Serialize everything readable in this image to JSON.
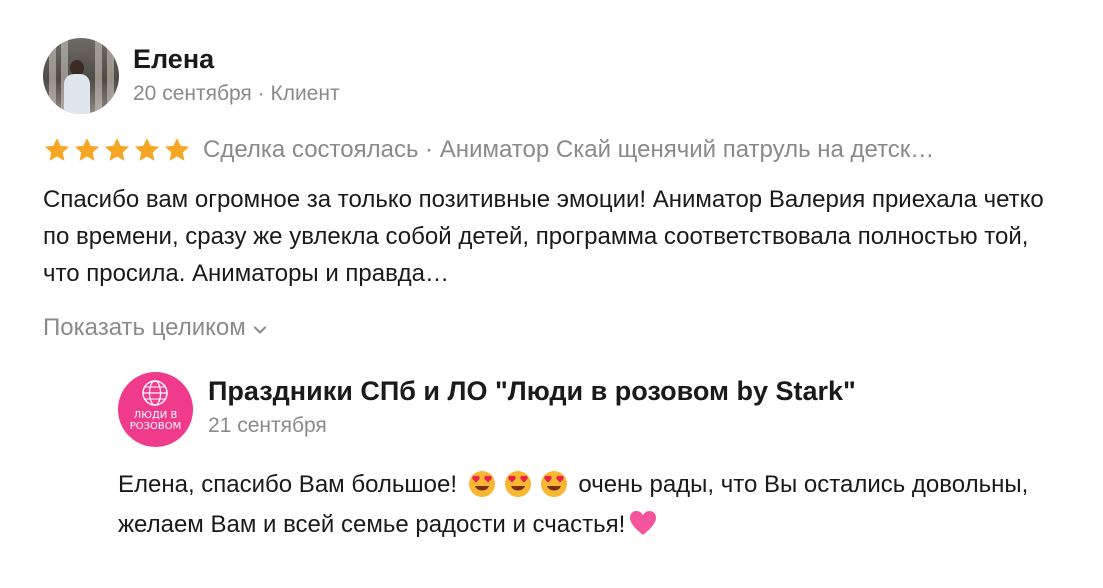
{
  "reviewer": {
    "name": "Елена",
    "meta": "20 сентября · Клиент",
    "avatar_icon": "user-photo-avatar"
  },
  "rating": {
    "stars": 5,
    "max_stars": 5,
    "star_color": "#f5a623",
    "deal_text": "Сделка состоялась · Аниматор Скай щенячий патруль на детск…"
  },
  "review": {
    "text": "Спасибо вам огромное за только позитивные эмоции! Аниматор Валерия приехала четко по времени, сразу же увлекла собой детей, программа соответствовала полностью той, что просила. Аниматоры и правда…",
    "show_more_label": "Показать целиком"
  },
  "reply": {
    "business_name": "Праздники СПб и ЛО \"Люди в розовом by Stark\"",
    "date": "21 сентября",
    "logo_text": "ЛЮДИ В РОЗОВОМ",
    "logo_color": "#f03a8c",
    "text_part1": "Елена, спасибо Вам большое!",
    "text_part2": "очень рады, что Вы остались довольны, желаем Вам и всей семье радости и счастья!",
    "emojis": [
      "heart-eyes-emoji",
      "heart-eyes-emoji",
      "heart-eyes-emoji",
      "pink-heart-emoji"
    ]
  },
  "colors": {
    "text_primary": "#1a1a1a",
    "text_secondary": "#8a8a8a",
    "background": "#ffffff"
  }
}
